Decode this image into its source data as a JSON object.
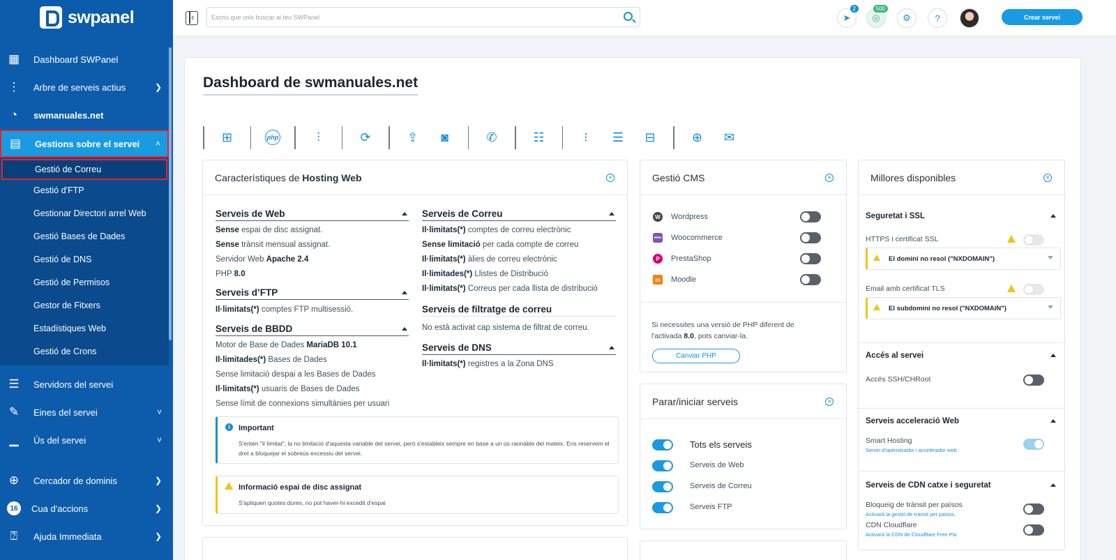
{
  "brand": {
    "name": "swpanel"
  },
  "sidebar": {
    "items": [
      {
        "label": "Dashboard SWPanel",
        "icon": "dashboard-icon"
      },
      {
        "label": "Arbre de serveis actius",
        "icon": "tree-icon"
      },
      {
        "label": "swmanuales.net",
        "icon": "speed-icon"
      },
      {
        "label": "Gestions sobre el servei",
        "icon": "server-settings-icon"
      },
      {
        "label": "Servidors del servei",
        "icon": "servers-icon"
      },
      {
        "label": "Eines del servei",
        "icon": "wrench-icon"
      },
      {
        "label": "Ús del servei",
        "icon": "chart-icon"
      },
      {
        "label": "Cercador de dominis",
        "icon": "globe-search-icon"
      },
      {
        "label": "Cua d'accions",
        "icon": "queue-icon",
        "badge": "16"
      },
      {
        "label": "Ajuda Immediata",
        "icon": "help-chat-icon"
      }
    ],
    "submenu": [
      "Gestió de Correu",
      "Gestió d'FTP",
      "Gestionar Directori arrel Web",
      "Gestió Bases de Dades",
      "Gestió de DNS",
      "Gestió de Permisos",
      "Gestor de Fitxers",
      "Estadístiques Web",
      "Gestió de Crons"
    ]
  },
  "topbar": {
    "search_placeholder": "Escriu que vols buscar al teu SWPanel",
    "notifications_badge": "2",
    "credits_badge": "500",
    "create_button": "Crear servei"
  },
  "page": {
    "title": "Dashboard de swmanuales.net"
  },
  "features": {
    "title_prefix": "Característiques de",
    "title_bold": "Hosting Web",
    "web": {
      "title": "Serveis de Web",
      "lines": [
        [
          "Sense",
          " espai de disc assignat."
        ],
        [
          "Sense",
          " trànsit mensual assignat."
        ],
        [
          "Servidor Web ",
          "Apache 2.4"
        ],
        [
          "PHP ",
          "8.0"
        ]
      ]
    },
    "ftp": {
      "title": "Serveis d’FTP",
      "lines": [
        [
          "Il·limitats(*)",
          " comptes FTP multisessió."
        ]
      ]
    },
    "bbdd": {
      "title": "Serveis de BBDD",
      "lines": [
        [
          "Motor de Base de Dades ",
          "MariaDB 10.1"
        ],
        [
          "Il·limitades(*)",
          " Bases de Dades"
        ],
        [
          "Sense limitació despai a les Bases de Dades",
          ""
        ],
        [
          "Il·limitats(*)",
          " usuaris de Bases de Dades"
        ],
        [
          "Sense límit de connexions simultànies per usuari",
          ""
        ]
      ]
    },
    "mail": {
      "title": "Serveis de Correu",
      "lines": [
        [
          "Il·limitats(*)",
          " comptes de correu electrònic"
        ],
        [
          "Sense limitació",
          " per cada compte de correu"
        ],
        [
          "Il·limitats(*)",
          " àlies de correu electrònic"
        ],
        [
          "Il·limitades(*)",
          " Llistes de Distribució"
        ],
        [
          "Il·limitats(*)",
          " Correus per cada llista de distribució"
        ]
      ]
    },
    "filter": {
      "title": "Serveis de filtratge de correu",
      "line": "No està activat cap sistema de filtrat de correu."
    },
    "dns": {
      "title": "Serveis de DNS",
      "lines": [
        [
          "Il·limitats(*)",
          " registres a la Zona DNS"
        ]
      ]
    },
    "important": {
      "title": "Important",
      "text": "S'entén \"il·limitat\", la no limitació d'aquesta variable del servei, però s'estableix sempre en base a un ús raonable del mateix. Ens reservem el dret a bloquejar el sobreús excessiu del servei."
    },
    "disk_info": {
      "title": "Informació espai de disc assignat",
      "text": "S'apliquen quotes dures, no pot haver-hi excedit d'espai"
    }
  },
  "cms": {
    "title": "Gestió CMS",
    "items": [
      {
        "label": "Wordpress",
        "on": false
      },
      {
        "label": "Woocommerce",
        "on": false
      },
      {
        "label": "PrestaShop",
        "on": false
      },
      {
        "label": "Moodle",
        "on": false
      }
    ],
    "php_note_a": "Si necessites una versió de PHP diferent de",
    "php_note_b": "l'activada ",
    "php_version": "8.0",
    "php_note_c": ", pots canviar-la.",
    "php_button": "Canviar PHP"
  },
  "services": {
    "title": "Parar/iniciar serveis",
    "items": [
      {
        "label": "Tots els serveis",
        "on": true
      },
      {
        "label": "Serveis de Web",
        "on": true
      },
      {
        "label": "Serveis de Correu",
        "on": true
      },
      {
        "label": "Serveis FTP",
        "on": true
      }
    ]
  },
  "upgrades": {
    "title": "Millores disponibles",
    "ssl": {
      "title": "Seguretat i SSL",
      "https_label": "HTTPS i certificat SSL",
      "https_warn": "El domini no resol (\"NXDOMAIN\")",
      "tls_label": "Email amb certificat TLS",
      "tls_warn": "El subdomini no resol (\"NXDOMAIN\")"
    },
    "access": {
      "title": "Accés al servei",
      "label": "Accés SSH/CHRoot"
    },
    "accel": {
      "title": "Serveis acceleració Web",
      "label": "Smart Hosting",
      "sub": "Servei d'optimitzador i accelerador web"
    },
    "cdn": {
      "title": "Serveis de CDN catxe i seguretat",
      "geo_label": "Bloqueig de trànsit per països",
      "geo_sub": "Activarà la gestió de trànsit per països.",
      "cf_label": "CDN Cloudflare",
      "cf_sub": "Activarà la CDN de Cloudflare Free Pla"
    }
  },
  "colors": {
    "sidebar": "#0d5cab",
    "accent": "#1a9ae0",
    "highlight": "#e62429",
    "warning": "#f2c511"
  }
}
